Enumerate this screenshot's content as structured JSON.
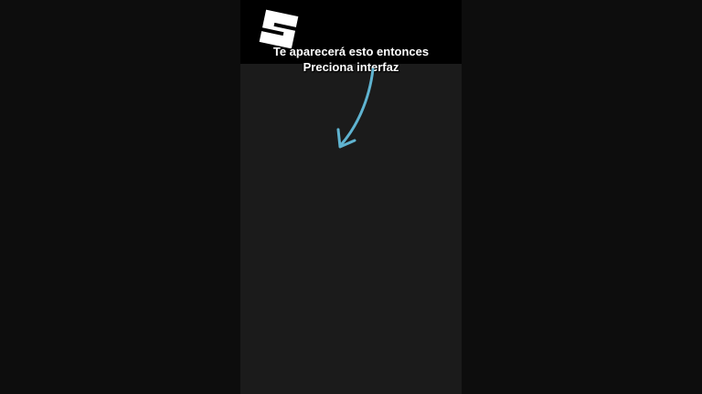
{
  "caption": {
    "line1": "Te aparecerá esto entonces",
    "line2": "Preciona interfaz"
  },
  "logo": {
    "icon": "studio-logo-icon",
    "color": "#ffffff"
  },
  "arrow": {
    "icon": "arrow-down-left-icon",
    "color": "#5fb3d0"
  },
  "colors": {
    "background": "#0c0c0c",
    "panel": "#1b1b1b",
    "header": "#000000"
  }
}
